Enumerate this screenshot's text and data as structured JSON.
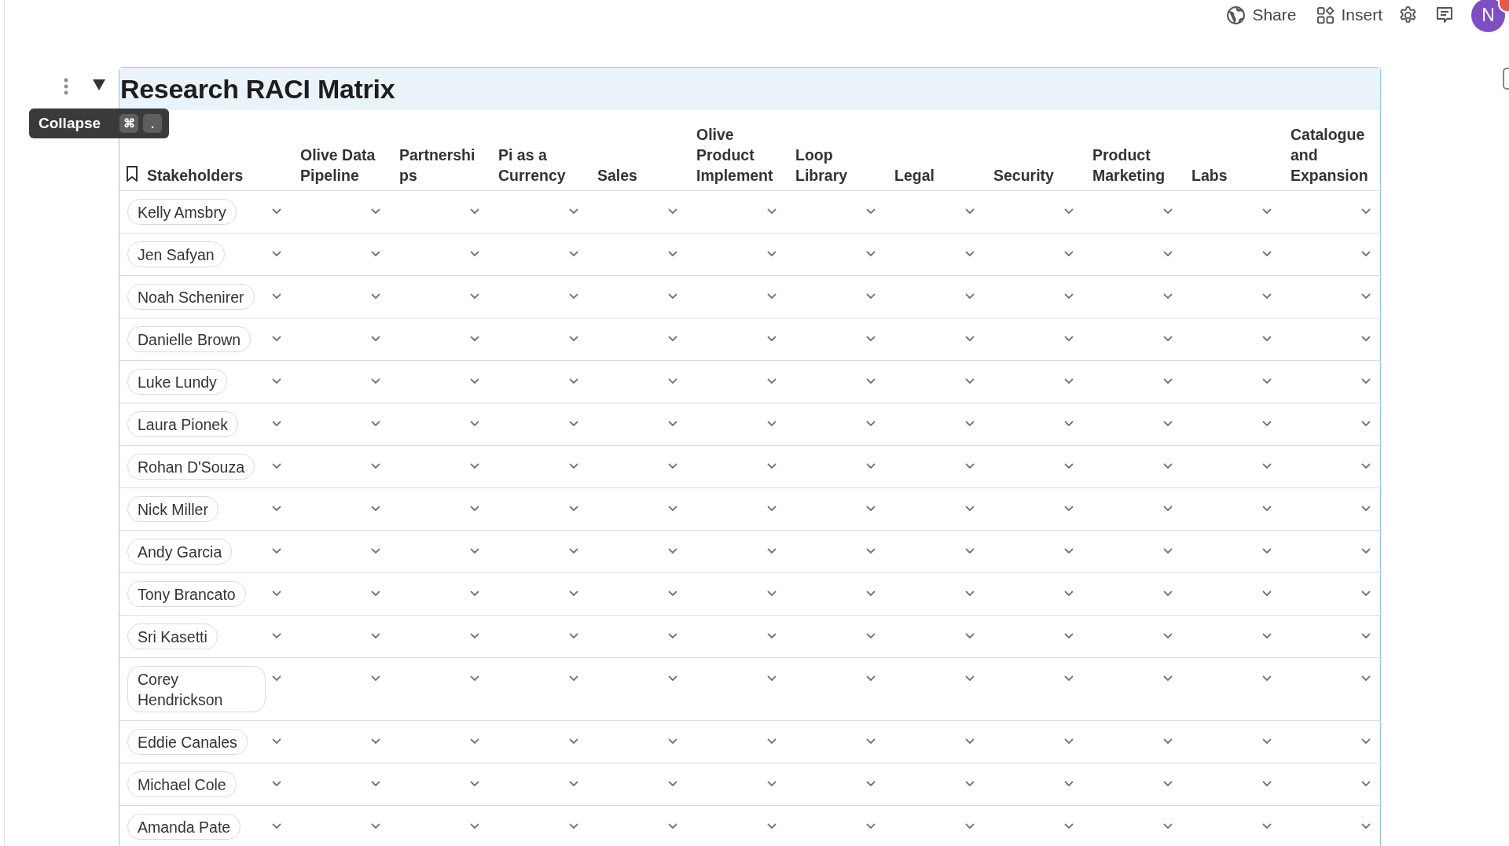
{
  "top_bar": {
    "share": "Share",
    "insert": "Insert",
    "avatar": "N"
  },
  "block": {
    "title": "Research RACI Matrix",
    "expanded": true,
    "tooltip": {
      "label": "Collapse",
      "keys": [
        "⌘",
        "."
      ]
    }
  },
  "table": {
    "columns": [
      "Stakeholders",
      "Olive Data Pipeline",
      "Partnerships",
      "Pi as a Currency",
      "Sales",
      "Olive Product Implement",
      "Loop Library",
      "Legal",
      "Security",
      "Product Marketing",
      "Labs",
      "Catalogue and Expansion"
    ],
    "rows": [
      {
        "name": "Kelly Amsbry"
      },
      {
        "name": "Jen Safyan"
      },
      {
        "name": "Noah Schenirer"
      },
      {
        "name": "Danielle Brown"
      },
      {
        "name": "Luke Lundy"
      },
      {
        "name": "Laura Pionek"
      },
      {
        "name": "Rohan D'Souza"
      },
      {
        "name": "Nick Miller"
      },
      {
        "name": "Andy Garcia"
      },
      {
        "name": "Tony Brancato"
      },
      {
        "name": "Sri Kasetti"
      },
      {
        "name": "Corey Hendrickson"
      },
      {
        "name": "Eddie Canales"
      },
      {
        "name": "Michael Cole"
      },
      {
        "name": "Amanda Pate"
      }
    ]
  }
}
